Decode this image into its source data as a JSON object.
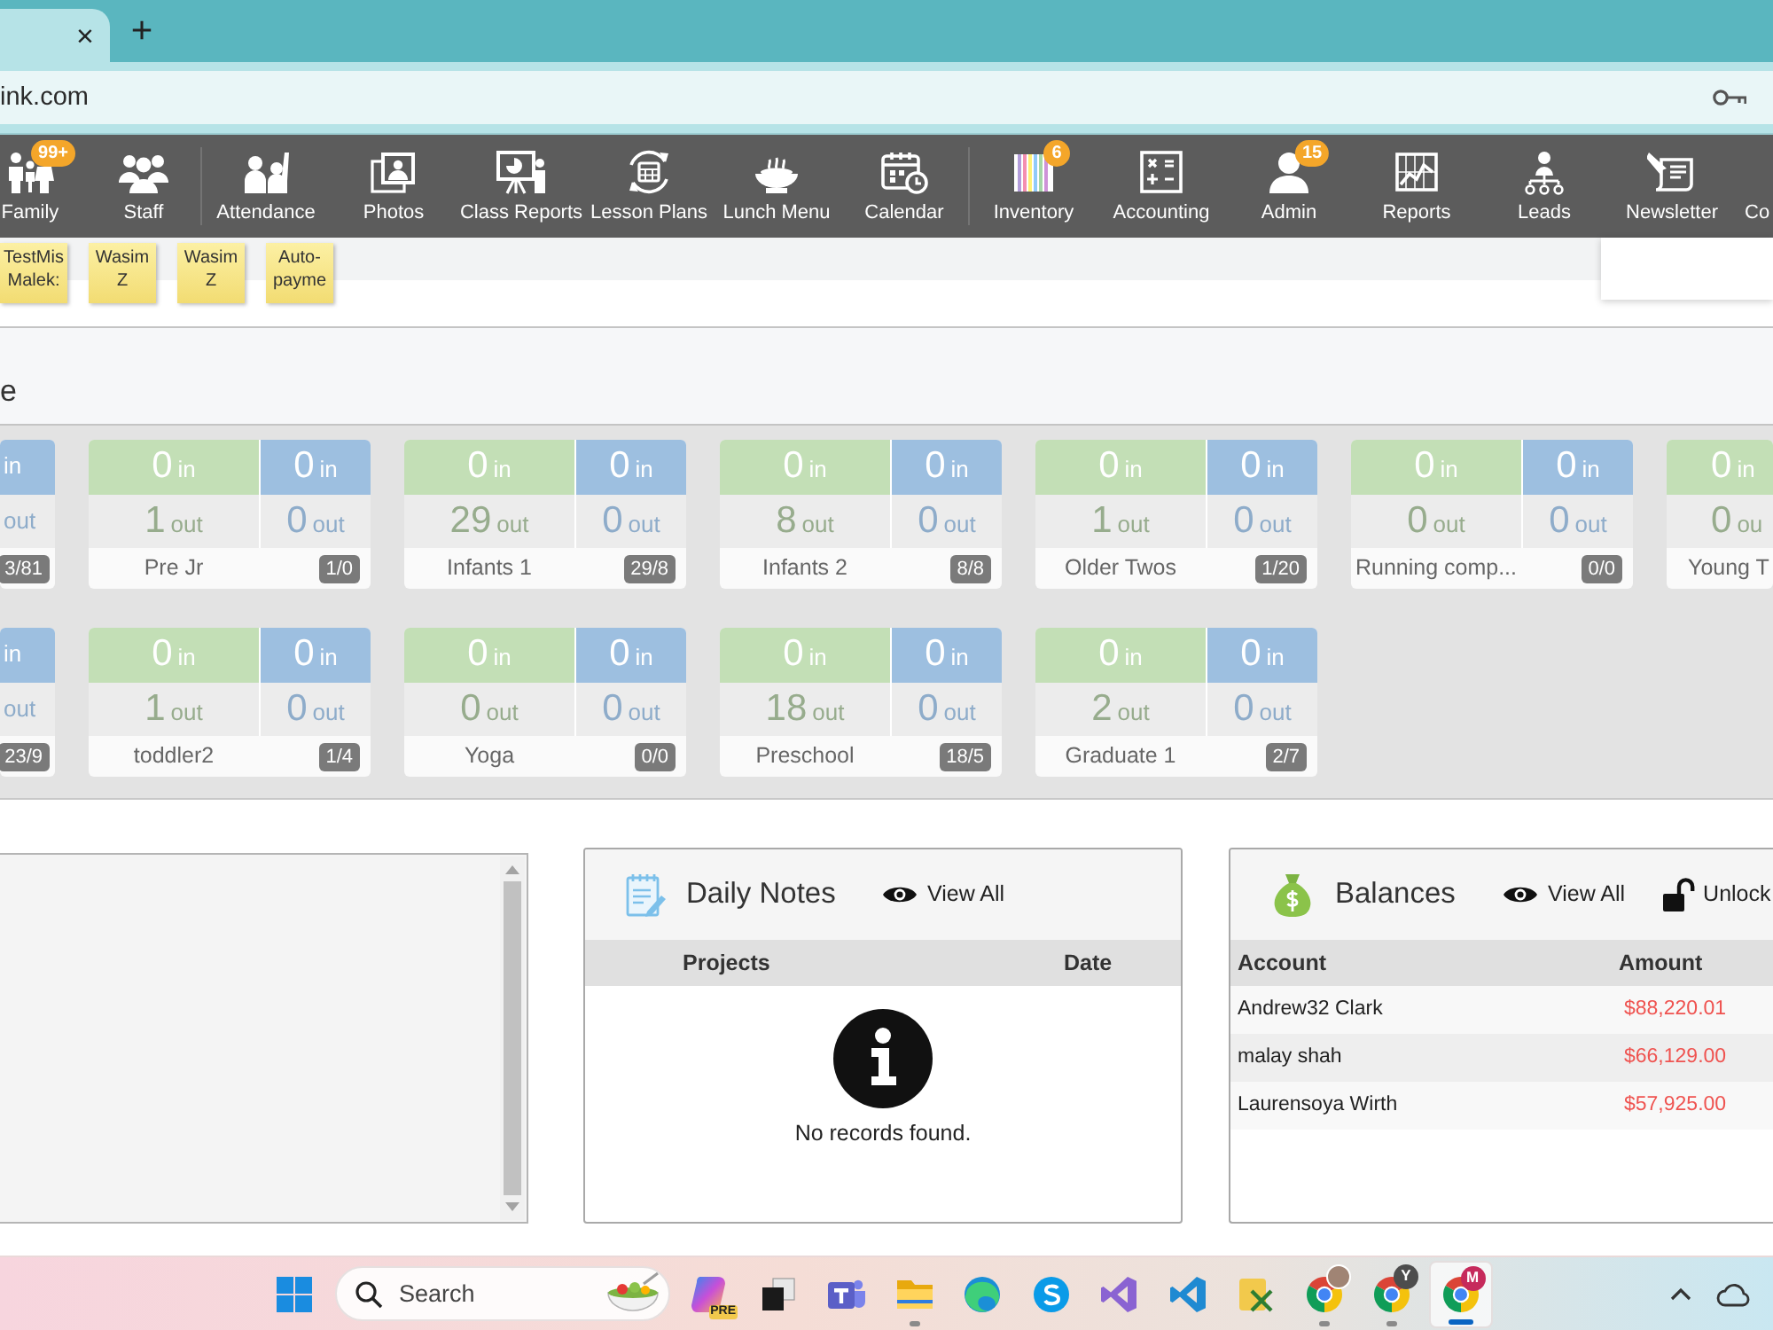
{
  "browser": {
    "tab": {
      "close": "×"
    },
    "new_tab": "+",
    "address": "ink.com"
  },
  "nav": {
    "groups": [
      {
        "items": [
          {
            "label": "Family",
            "badge": "99+"
          },
          {
            "label": "Staff"
          }
        ]
      },
      {
        "items": [
          {
            "label": "Attendance"
          },
          {
            "label": "Photos"
          },
          {
            "label": "Class Reports"
          },
          {
            "label": "Lesson Plans"
          },
          {
            "label": "Lunch Menu"
          },
          {
            "label": "Calendar"
          }
        ]
      },
      {
        "items": [
          {
            "label": "Inventory",
            "badge": "6"
          },
          {
            "label": "Accounting"
          },
          {
            "label": "Admin",
            "badge": "15"
          },
          {
            "label": "Reports"
          },
          {
            "label": "Leads"
          },
          {
            "label": "Newsletter"
          },
          {
            "label": "Co"
          }
        ]
      }
    ]
  },
  "sticky_notes": [
    {
      "lines": [
        "TestMis",
        "Malek:"
      ]
    },
    {
      "lines": [
        "Wasim",
        "Z"
      ]
    },
    {
      "lines": [
        "Wasim",
        "Z"
      ]
    },
    {
      "lines": [
        "Auto-",
        "payme"
      ]
    }
  ],
  "section": {
    "title": "e"
  },
  "classroom_rows": [
    {
      "cards": [
        {
          "kind": "tail",
          "badge": "3/81",
          "columns": [
            {
              "color": "#9dbfe0",
              "in_unit": "in",
              "out_unit": "out"
            }
          ]
        },
        {
          "kind": "full",
          "name": "Pre Jr",
          "badge": "1/0",
          "columns": [
            {
              "color": "#c3dfb6",
              "in_count": "0",
              "in_unit": "in",
              "out_count": "1",
              "out_unit": "out"
            },
            {
              "color": "#9dbfe0",
              "in_count": "0",
              "in_unit": "in",
              "out_count": "0",
              "out_unit": "out"
            }
          ]
        },
        {
          "kind": "full",
          "name": "Infants 1",
          "badge": "29/8",
          "columns": [
            {
              "color": "#c3dfb6",
              "in_count": "0",
              "in_unit": "in",
              "out_count": "29",
              "out_unit": "out"
            },
            {
              "color": "#9dbfe0",
              "in_count": "0",
              "in_unit": "in",
              "out_count": "0",
              "out_unit": "out"
            }
          ]
        },
        {
          "kind": "full",
          "name": "Infants 2",
          "badge": "8/8",
          "columns": [
            {
              "color": "#c3dfb6",
              "in_count": "0",
              "in_unit": "in",
              "out_count": "8",
              "out_unit": "out"
            },
            {
              "color": "#9dbfe0",
              "in_count": "0",
              "in_unit": "in",
              "out_count": "0",
              "out_unit": "out"
            }
          ]
        },
        {
          "kind": "full",
          "name": "Older Twos",
          "badge": "1/20",
          "columns": [
            {
              "color": "#c3dfb6",
              "in_count": "0",
              "in_unit": "in",
              "out_count": "1",
              "out_unit": "out"
            },
            {
              "color": "#9dbfe0",
              "in_count": "0",
              "in_unit": "in",
              "out_count": "0",
              "out_unit": "out"
            }
          ]
        },
        {
          "kind": "full",
          "name": "Running comp...",
          "badge": "0/0",
          "columns": [
            {
              "color": "#c3dfb6",
              "in_count": "0",
              "in_unit": "in",
              "out_count": "0",
              "out_unit": "out"
            },
            {
              "color": "#9dbfe0",
              "in_count": "0",
              "in_unit": "in",
              "out_count": "0",
              "out_unit": "out"
            }
          ]
        },
        {
          "kind": "head",
          "name": "Young T",
          "columns": [
            {
              "color": "#c3dfb6",
              "in_count": "0",
              "in_unit": "in",
              "out_count": "0",
              "out_unit": "ou"
            }
          ]
        }
      ]
    },
    {
      "cards": [
        {
          "kind": "tail",
          "badge": "23/9",
          "columns": [
            {
              "color": "#9dbfe0",
              "in_unit": "in",
              "out_unit": "out"
            }
          ]
        },
        {
          "kind": "full",
          "name": "toddler2",
          "badge": "1/4",
          "columns": [
            {
              "color": "#c3dfb6",
              "in_count": "0",
              "in_unit": "in",
              "out_count": "1",
              "out_unit": "out"
            },
            {
              "color": "#9dbfe0",
              "in_count": "0",
              "in_unit": "in",
              "out_count": "0",
              "out_unit": "out"
            }
          ]
        },
        {
          "kind": "full",
          "name": "Yoga",
          "badge": "0/0",
          "columns": [
            {
              "color": "#c3dfb6",
              "in_count": "0",
              "in_unit": "in",
              "out_count": "0",
              "out_unit": "out"
            },
            {
              "color": "#9dbfe0",
              "in_count": "0",
              "in_unit": "in",
              "out_count": "0",
              "out_unit": "out"
            }
          ]
        },
        {
          "kind": "full",
          "name": "Preschool",
          "badge": "18/5",
          "columns": [
            {
              "color": "#c3dfb6",
              "in_count": "0",
              "in_unit": "in",
              "out_count": "18",
              "out_unit": "out"
            },
            {
              "color": "#9dbfe0",
              "in_count": "0",
              "in_unit": "in",
              "out_count": "0",
              "out_unit": "out"
            }
          ]
        },
        {
          "kind": "full",
          "name": "Graduate 1",
          "badge": "2/7",
          "columns": [
            {
              "color": "#c3dfb6",
              "in_count": "0",
              "in_unit": "in",
              "out_count": "2",
              "out_unit": "out"
            },
            {
              "color": "#9dbfe0",
              "in_count": "0",
              "in_unit": "in",
              "out_count": "0",
              "out_unit": "out"
            }
          ]
        }
      ]
    }
  ],
  "daily_notes": {
    "title": "Daily Notes",
    "view_all": "View All",
    "columns": [
      "Projects",
      "Date"
    ],
    "empty_message": "No records found."
  },
  "balances": {
    "title": "Balances",
    "view_all": "View All",
    "unlock": "Unlock",
    "columns": [
      "Account",
      "Amount"
    ],
    "rows": [
      {
        "account": "Andrew32 Clark",
        "amount": "$88,220.01"
      },
      {
        "account": "malay shah",
        "amount": "$66,129.00"
      },
      {
        "account": "Laurensoya Wirth",
        "amount": "$57,925.00"
      }
    ]
  },
  "taskbar": {
    "search": {
      "placeholder": "Search"
    },
    "apps": [
      {
        "selected": false,
        "running": false,
        "badge": {
          "kind": "label",
          "text": "PRE",
          "color": "#f2c94c"
        }
      },
      {
        "selected": false,
        "running": false
      },
      {
        "selected": false,
        "running": false
      },
      {
        "selected": false,
        "running": true
      },
      {
        "selected": false,
        "running": false
      },
      {
        "selected": false,
        "running": false
      },
      {
        "selected": false,
        "running": false
      },
      {
        "selected": false,
        "running": false
      },
      {
        "selected": false,
        "running": false
      },
      {
        "selected": false,
        "running": true,
        "profile_photo": true
      },
      {
        "selected": false,
        "running": true,
        "badge": {
          "kind": "profile",
          "text": "Y",
          "color": "#4d4d4d"
        }
      },
      {
        "selected": true,
        "running": true,
        "badge": {
          "kind": "profile",
          "text": "M",
          "color": "#c62a5c"
        }
      }
    ]
  }
}
